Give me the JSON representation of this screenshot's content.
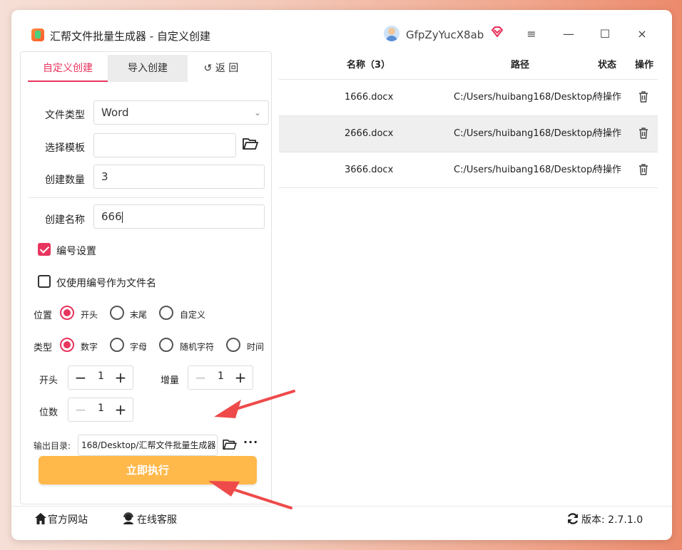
{
  "titlebar": {
    "title": "汇帮文件批量生成器 - 自定义创建",
    "username": "GfpZyYucX8ab",
    "menu_icon": "≡",
    "minimize_icon": "—",
    "maximize_icon": "☐",
    "close_icon": "×"
  },
  "tabs": {
    "custom": "自定义创建",
    "import": "导入创建",
    "back": "↺ 返 回"
  },
  "form": {
    "file_type_label": "文件类型",
    "file_type_value": "Word",
    "template_label": "选择模板",
    "template_value": "",
    "count_label": "创建数量",
    "count_value": "3",
    "name_label": "创建名称",
    "name_value": "666",
    "numbering_label": "编号设置",
    "numbering_checked": true,
    "only_number_label": "仅使用编号作为文件名",
    "only_number_checked": false,
    "position_label": "位置",
    "position_options": [
      "开头",
      "末尾",
      "自定义"
    ],
    "position_selected": "开头",
    "type_label": "类型",
    "type_options": [
      "数字",
      "字母",
      "随机字符",
      "时间"
    ],
    "type_selected": "数字",
    "start_label": "开头",
    "start_value": "1",
    "increment_label": "增量",
    "increment_value": "1",
    "digits_label": "位数",
    "digits_value": "1",
    "output_label": "输出目录:",
    "output_value": "168/Desktop/汇帮文件批量生成器",
    "run_label": "立即执行"
  },
  "table": {
    "headers": [
      "名称（3）",
      "路径",
      "状态",
      "操作"
    ],
    "rows": [
      {
        "name": "1666.docx",
        "path": "C:/Users/huibang168/Desktop/",
        "status": "待操作"
      },
      {
        "name": "2666.docx",
        "path": "C:/Users/huibang168/Desktop/",
        "status": "待操作"
      },
      {
        "name": "3666.docx",
        "path": "C:/Users/huibang168/Desktop/",
        "status": "待操作"
      }
    ]
  },
  "footer": {
    "website": "官方网站",
    "support": "在线客服",
    "version": "版本:  2.7.1.0"
  },
  "colors": {
    "accent": "#e8355e",
    "run_button": "#ffb84a",
    "annotation_arrow": "#ef4a4a"
  }
}
